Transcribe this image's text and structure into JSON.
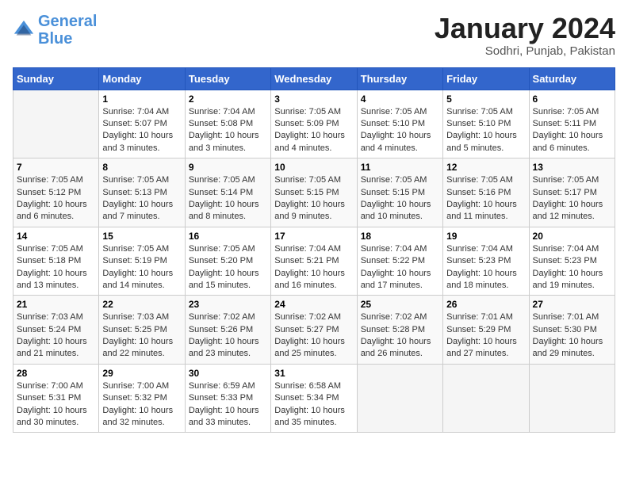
{
  "header": {
    "logo_line1": "General",
    "logo_line2": "Blue",
    "title": "January 2024",
    "subtitle": "Sodhri, Punjab, Pakistan"
  },
  "calendar": {
    "days_of_week": [
      "Sunday",
      "Monday",
      "Tuesday",
      "Wednesday",
      "Thursday",
      "Friday",
      "Saturday"
    ],
    "weeks": [
      [
        {
          "day": "",
          "info": ""
        },
        {
          "day": "1",
          "info": "Sunrise: 7:04 AM\nSunset: 5:07 PM\nDaylight: 10 hours\nand 3 minutes."
        },
        {
          "day": "2",
          "info": "Sunrise: 7:04 AM\nSunset: 5:08 PM\nDaylight: 10 hours\nand 3 minutes."
        },
        {
          "day": "3",
          "info": "Sunrise: 7:05 AM\nSunset: 5:09 PM\nDaylight: 10 hours\nand 4 minutes."
        },
        {
          "day": "4",
          "info": "Sunrise: 7:05 AM\nSunset: 5:10 PM\nDaylight: 10 hours\nand 4 minutes."
        },
        {
          "day": "5",
          "info": "Sunrise: 7:05 AM\nSunset: 5:10 PM\nDaylight: 10 hours\nand 5 minutes."
        },
        {
          "day": "6",
          "info": "Sunrise: 7:05 AM\nSunset: 5:11 PM\nDaylight: 10 hours\nand 6 minutes."
        }
      ],
      [
        {
          "day": "7",
          "info": "Sunrise: 7:05 AM\nSunset: 5:12 PM\nDaylight: 10 hours\nand 6 minutes."
        },
        {
          "day": "8",
          "info": "Sunrise: 7:05 AM\nSunset: 5:13 PM\nDaylight: 10 hours\nand 7 minutes."
        },
        {
          "day": "9",
          "info": "Sunrise: 7:05 AM\nSunset: 5:14 PM\nDaylight: 10 hours\nand 8 minutes."
        },
        {
          "day": "10",
          "info": "Sunrise: 7:05 AM\nSunset: 5:15 PM\nDaylight: 10 hours\nand 9 minutes."
        },
        {
          "day": "11",
          "info": "Sunrise: 7:05 AM\nSunset: 5:15 PM\nDaylight: 10 hours\nand 10 minutes."
        },
        {
          "day": "12",
          "info": "Sunrise: 7:05 AM\nSunset: 5:16 PM\nDaylight: 10 hours\nand 11 minutes."
        },
        {
          "day": "13",
          "info": "Sunrise: 7:05 AM\nSunset: 5:17 PM\nDaylight: 10 hours\nand 12 minutes."
        }
      ],
      [
        {
          "day": "14",
          "info": "Sunrise: 7:05 AM\nSunset: 5:18 PM\nDaylight: 10 hours\nand 13 minutes."
        },
        {
          "day": "15",
          "info": "Sunrise: 7:05 AM\nSunset: 5:19 PM\nDaylight: 10 hours\nand 14 minutes."
        },
        {
          "day": "16",
          "info": "Sunrise: 7:05 AM\nSunset: 5:20 PM\nDaylight: 10 hours\nand 15 minutes."
        },
        {
          "day": "17",
          "info": "Sunrise: 7:04 AM\nSunset: 5:21 PM\nDaylight: 10 hours\nand 16 minutes."
        },
        {
          "day": "18",
          "info": "Sunrise: 7:04 AM\nSunset: 5:22 PM\nDaylight: 10 hours\nand 17 minutes."
        },
        {
          "day": "19",
          "info": "Sunrise: 7:04 AM\nSunset: 5:23 PM\nDaylight: 10 hours\nand 18 minutes."
        },
        {
          "day": "20",
          "info": "Sunrise: 7:04 AM\nSunset: 5:23 PM\nDaylight: 10 hours\nand 19 minutes."
        }
      ],
      [
        {
          "day": "21",
          "info": "Sunrise: 7:03 AM\nSunset: 5:24 PM\nDaylight: 10 hours\nand 21 minutes."
        },
        {
          "day": "22",
          "info": "Sunrise: 7:03 AM\nSunset: 5:25 PM\nDaylight: 10 hours\nand 22 minutes."
        },
        {
          "day": "23",
          "info": "Sunrise: 7:02 AM\nSunset: 5:26 PM\nDaylight: 10 hours\nand 23 minutes."
        },
        {
          "day": "24",
          "info": "Sunrise: 7:02 AM\nSunset: 5:27 PM\nDaylight: 10 hours\nand 25 minutes."
        },
        {
          "day": "25",
          "info": "Sunrise: 7:02 AM\nSunset: 5:28 PM\nDaylight: 10 hours\nand 26 minutes."
        },
        {
          "day": "26",
          "info": "Sunrise: 7:01 AM\nSunset: 5:29 PM\nDaylight: 10 hours\nand 27 minutes."
        },
        {
          "day": "27",
          "info": "Sunrise: 7:01 AM\nSunset: 5:30 PM\nDaylight: 10 hours\nand 29 minutes."
        }
      ],
      [
        {
          "day": "28",
          "info": "Sunrise: 7:00 AM\nSunset: 5:31 PM\nDaylight: 10 hours\nand 30 minutes."
        },
        {
          "day": "29",
          "info": "Sunrise: 7:00 AM\nSunset: 5:32 PM\nDaylight: 10 hours\nand 32 minutes."
        },
        {
          "day": "30",
          "info": "Sunrise: 6:59 AM\nSunset: 5:33 PM\nDaylight: 10 hours\nand 33 minutes."
        },
        {
          "day": "31",
          "info": "Sunrise: 6:58 AM\nSunset: 5:34 PM\nDaylight: 10 hours\nand 35 minutes."
        },
        {
          "day": "",
          "info": ""
        },
        {
          "day": "",
          "info": ""
        },
        {
          "day": "",
          "info": ""
        }
      ]
    ]
  }
}
